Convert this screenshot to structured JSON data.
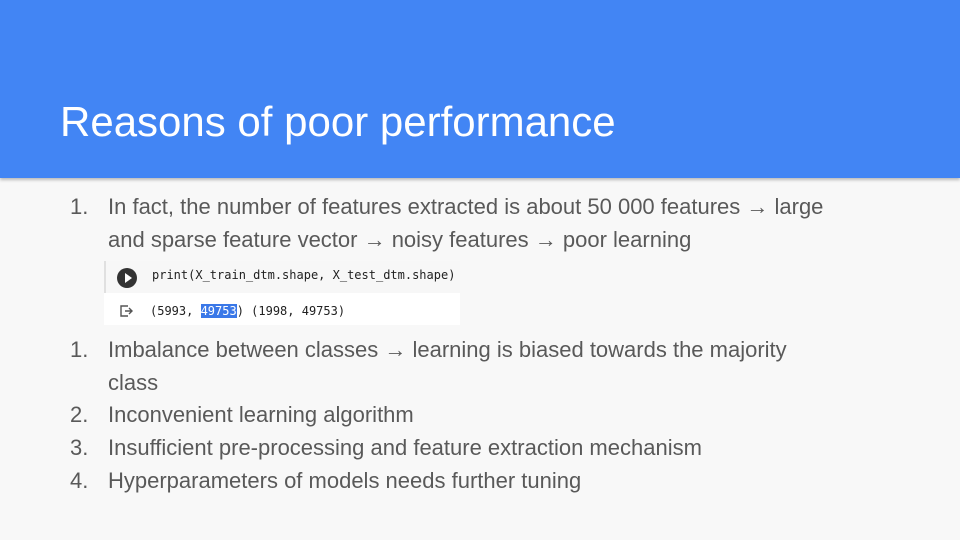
{
  "title": "Reasons of poor performance",
  "item1": {
    "num": "1.",
    "line1": "In fact, the number of features extracted is about 50 000 features → large",
    "line2": "and sparse feature vector → noisy features → poor learning"
  },
  "code": {
    "input": "print(X_train_dtm.shape, X_test_dtm.shape)",
    "out_prefix": "(5993, ",
    "out_highlight": "49753",
    "out_suffix": ") (1998, 49753)"
  },
  "items": [
    {
      "num": "1.",
      "line1": "Imbalance between classes → learning is biased towards the majority",
      "line2": "class"
    },
    {
      "num": "2.",
      "line1": "Inconvenient learning algorithm"
    },
    {
      "num": "3.",
      "line1": "Insufficient pre-processing and feature extraction mechanism"
    },
    {
      "num": "4.",
      "line1": "Hyperparameters of models needs further tuning"
    }
  ],
  "colors": {
    "header": "#4285f4",
    "body_text": "#595959",
    "highlight": "#3a78e8"
  }
}
